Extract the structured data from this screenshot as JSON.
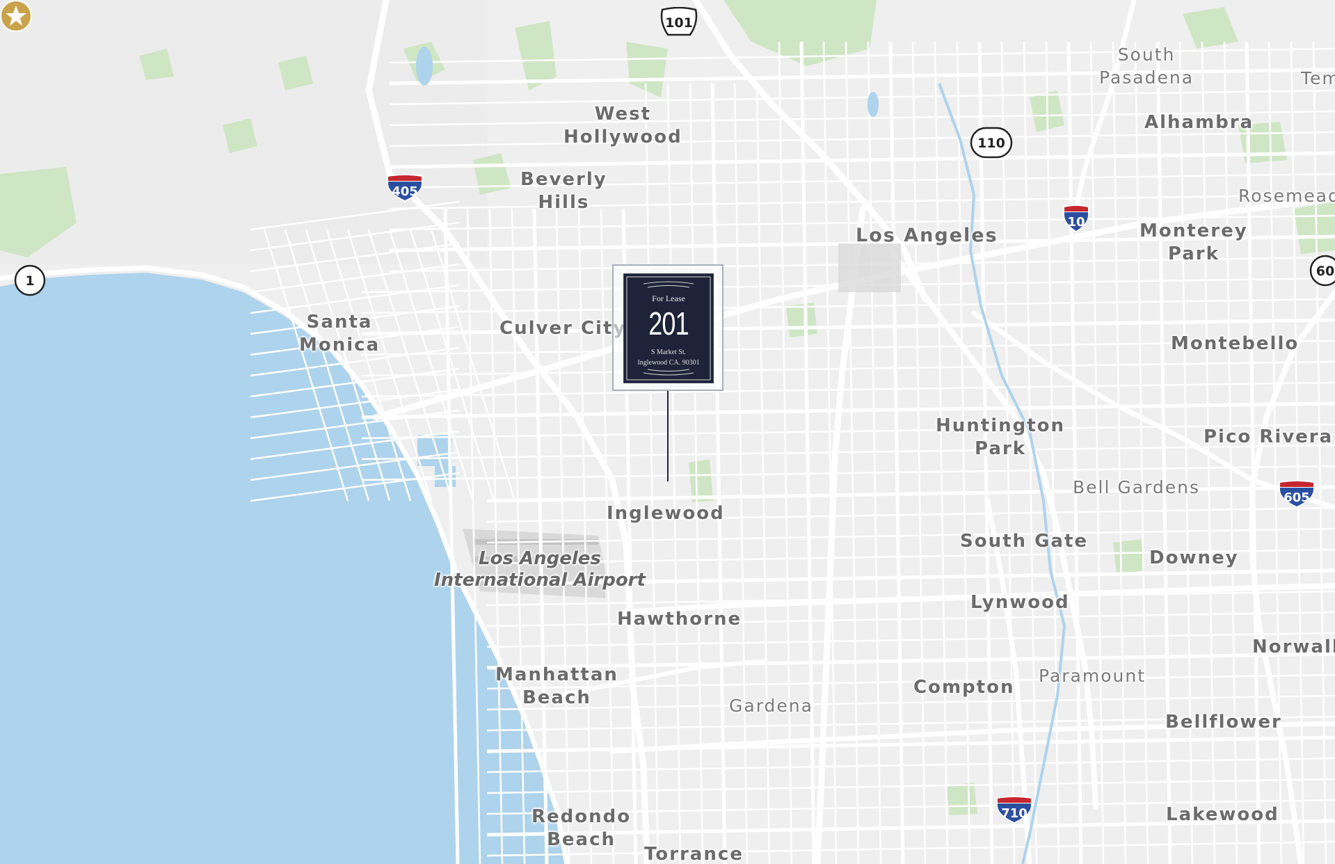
{
  "map": {
    "colors": {
      "water": "#aed3ec",
      "land": "#efefef",
      "park": "#cfe6c4",
      "road": "#ffffff",
      "minor_road": "#fbfbfb",
      "label": "#6b6b6b",
      "interstate_blue": "#2b4fa0",
      "interstate_red": "#c6262e",
      "pin_navy": "#1e2339",
      "pin_gold": "#c9a24a"
    }
  },
  "labels": [
    {
      "id": "west-hollywood",
      "lines": [
        "West",
        "Hollywood"
      ],
      "kind": "city"
    },
    {
      "id": "beverly-hills",
      "lines": [
        "Beverly",
        "Hills"
      ],
      "kind": "city"
    },
    {
      "id": "los-angeles",
      "lines": [
        "Los Angeles"
      ],
      "kind": "city"
    },
    {
      "id": "south-pasadena",
      "lines": [
        "South",
        "Pasadena"
      ],
      "kind": "minor"
    },
    {
      "id": "alhambra",
      "lines": [
        "Alhambra"
      ],
      "kind": "city"
    },
    {
      "id": "temple",
      "lines": [
        "Tem"
      ],
      "kind": "minor"
    },
    {
      "id": "rosemead",
      "lines": [
        "Rosemead"
      ],
      "kind": "minor"
    },
    {
      "id": "monterey-park",
      "lines": [
        "Monterey",
        "Park"
      ],
      "kind": "city"
    },
    {
      "id": "santa-monica",
      "lines": [
        "Santa",
        "Monica"
      ],
      "kind": "city"
    },
    {
      "id": "culver-city",
      "lines": [
        "Culver City"
      ],
      "kind": "city"
    },
    {
      "id": "montebello",
      "lines": [
        "Montebello"
      ],
      "kind": "city"
    },
    {
      "id": "huntington-park",
      "lines": [
        "Huntington",
        "Park"
      ],
      "kind": "city"
    },
    {
      "id": "pico-rivera",
      "lines": [
        "Pico Rivera"
      ],
      "kind": "city"
    },
    {
      "id": "bell-gardens",
      "lines": [
        "Bell Gardens"
      ],
      "kind": "minor"
    },
    {
      "id": "inglewood",
      "lines": [
        "Inglewood"
      ],
      "kind": "city"
    },
    {
      "id": "south-gate",
      "lines": [
        "South Gate"
      ],
      "kind": "city"
    },
    {
      "id": "downey",
      "lines": [
        "Downey"
      ],
      "kind": "city"
    },
    {
      "id": "lax",
      "lines": [
        "Los Angeles",
        "International Airport"
      ],
      "kind": "airport"
    },
    {
      "id": "lynwood",
      "lines": [
        "Lynwood"
      ],
      "kind": "city"
    },
    {
      "id": "hawthorne",
      "lines": [
        "Hawthorne"
      ],
      "kind": "city"
    },
    {
      "id": "norwalk",
      "lines": [
        "Norwalk"
      ],
      "kind": "city"
    },
    {
      "id": "manhattan-beach",
      "lines": [
        "Manhattan",
        "Beach"
      ],
      "kind": "city"
    },
    {
      "id": "paramount",
      "lines": [
        "Paramount"
      ],
      "kind": "minor"
    },
    {
      "id": "compton",
      "lines": [
        "Compton"
      ],
      "kind": "city"
    },
    {
      "id": "gardena",
      "lines": [
        "Gardena"
      ],
      "kind": "minor"
    },
    {
      "id": "bellflower",
      "lines": [
        "Bellflower"
      ],
      "kind": "city"
    },
    {
      "id": "redondo-beach",
      "lines": [
        "Redondo",
        "Beach"
      ],
      "kind": "city"
    },
    {
      "id": "lakewood",
      "lines": [
        "Lakewood"
      ],
      "kind": "city"
    },
    {
      "id": "torrance",
      "lines": [
        "Torrance"
      ],
      "kind": "city"
    }
  ],
  "shields": [
    {
      "id": "us-101",
      "number": "101",
      "type": "us"
    },
    {
      "id": "ca-110",
      "number": "110",
      "type": "state"
    },
    {
      "id": "ca-1",
      "number": "1",
      "type": "state"
    },
    {
      "id": "ca-60",
      "number": "60",
      "type": "state"
    },
    {
      "id": "i-405",
      "number": "405",
      "type": "interstate"
    },
    {
      "id": "i-10",
      "number": "10",
      "type": "interstate"
    },
    {
      "id": "i-605",
      "number": "605",
      "type": "interstate"
    },
    {
      "id": "i-710",
      "number": "710",
      "type": "interstate"
    }
  ],
  "pin": {
    "status": "For Lease",
    "number": "201",
    "address_line1": "S Market St.",
    "address_line2": "Inglewood CA. 90301",
    "icon": "star-icon"
  }
}
